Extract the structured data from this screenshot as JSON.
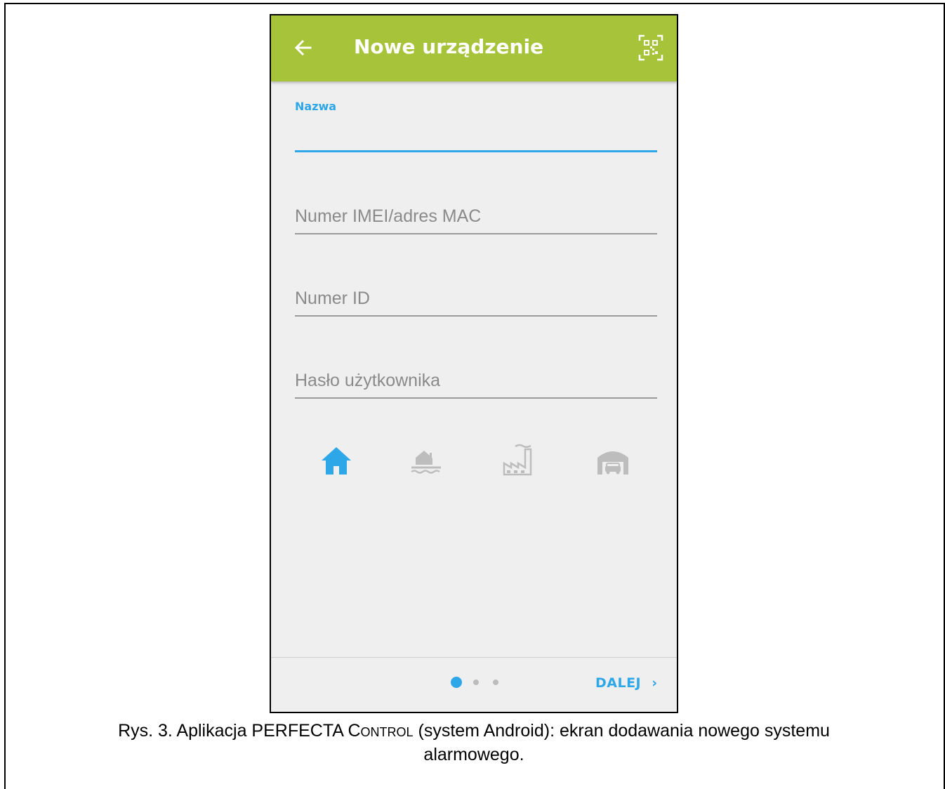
{
  "appbar": {
    "title": "Nowe urządzenie",
    "back_icon": "arrow-left-icon",
    "qr_icon": "qr-code-icon",
    "color": "#a6c33a"
  },
  "form": {
    "name_label": "Nazwa",
    "name_value": "",
    "imei_placeholder": "Numer IMEI/adres MAC",
    "id_placeholder": "Numer ID",
    "password_placeholder": "Hasło użytkownika",
    "accent_color": "#2ea7e8"
  },
  "object_types": [
    {
      "icon": "house-icon",
      "selected": true
    },
    {
      "icon": "house-by-water-icon",
      "selected": false
    },
    {
      "icon": "factory-icon",
      "selected": false
    },
    {
      "icon": "garage-icon",
      "selected": false
    }
  ],
  "footer": {
    "page_current": 1,
    "page_total": 3,
    "next_label": "DALEJ",
    "next_icon": "chevron-right-icon"
  },
  "caption": {
    "prefix": "Rys. 3. Aplikacja PERFECTA C",
    "smallcaps": "ontrol",
    "suffix_line1": " (system Android): ekran dodawania nowego systemu",
    "line2": "alarmowego."
  }
}
